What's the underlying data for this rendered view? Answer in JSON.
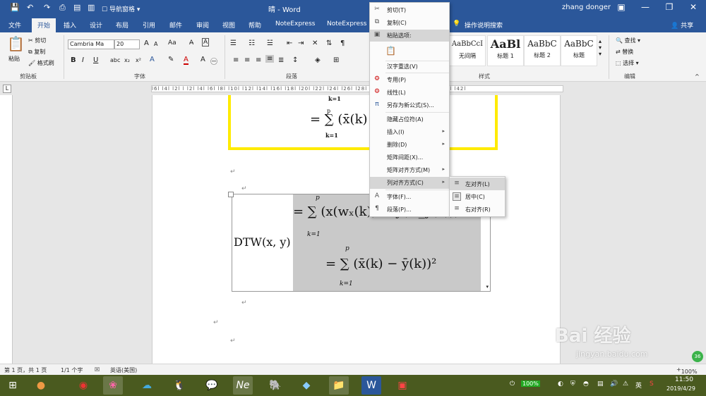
{
  "titlebar": {
    "doc_title": "晴 - Word",
    "nav_pane_label": "导航窗格",
    "user_name": "zhang donger"
  },
  "tabs": [
    "文件",
    "开始",
    "插入",
    "设计",
    "布局",
    "引用",
    "邮件",
    "审阅",
    "视图",
    "帮助",
    "NoteExpress",
    "NoteExpress"
  ],
  "tell_me": "操作说明搜索",
  "share": "共享",
  "ribbon": {
    "clipboard": {
      "paste": "粘贴",
      "cut": "剪切",
      "copy": "复制",
      "format_painter": "格式刷",
      "group": "剪贴板"
    },
    "font": {
      "name": "Cambria Ma",
      "size": "20",
      "grow": "A",
      "shrink": "A",
      "case": "Aa",
      "group": "字体"
    },
    "paragraph": {
      "group": "段落"
    },
    "styles": {
      "group": "样式",
      "items": [
        {
          "sample": "AaBbCcI",
          "name": "无间隔"
        },
        {
          "sample": "AaBl",
          "name": "标题 1"
        },
        {
          "sample": "AaBbC",
          "name": "标题 2"
        },
        {
          "sample": "AaBbC",
          "name": "标题"
        }
      ]
    },
    "editing": {
      "find": "查找",
      "replace": "替换",
      "select": "选择",
      "group": "编辑"
    }
  },
  "ruler_text": "l6l l4l l2l l l2l l4l l6l l8l l10l l12l l14l l16l l18l l20l l22l l24l l26l l28l l30l l32l l34l l36l l38l l40l l42l",
  "document": {
    "upper_eq_top": "k=1",
    "upper_eq_main": "= ∑ (x̄(k)",
    "upper_eq_p": "p",
    "upper_eq_k": "k=1",
    "dtw_label": "DTW(x, y)",
    "eq1": "= ∑ (x(wₓ(k)) − y(w_y(k)))",
    "eq1_p": "p",
    "eq1_k": "k=1",
    "eq2": "= ∑ (x̄(k) − ȳ(k))²",
    "eq2_p": "p",
    "eq2_k": "k=1",
    "para_mark": "↵"
  },
  "context_menu": {
    "items": [
      {
        "icon": "scissors-icon",
        "glyph": "✂",
        "label": "剪切(T)"
      },
      {
        "icon": "copy-icon",
        "glyph": "⧉",
        "label": "复制(C)"
      },
      {
        "icon": "paste-icon",
        "glyph": "📋",
        "label": "粘贴选项:"
      },
      {
        "icon": "",
        "glyph": "",
        "label": "汉字重选(V)"
      },
      {
        "icon": "special-icon",
        "glyph": "⚙",
        "label": "专用(P)"
      },
      {
        "icon": "linear-icon",
        "glyph": "⚙",
        "label": "线性(L)"
      },
      {
        "icon": "save-equation-icon",
        "glyph": "π",
        "label": "另存为新公式(S)..."
      },
      {
        "icon": "",
        "glyph": "",
        "label": "隐藏占位符(A)"
      },
      {
        "icon": "",
        "glyph": "",
        "label": "插入(I)"
      },
      {
        "icon": "",
        "glyph": "",
        "label": "删除(D)"
      },
      {
        "icon": "",
        "glyph": "",
        "label": "矩阵间距(X)..."
      },
      {
        "icon": "",
        "glyph": "",
        "label": "矩阵对齐方式(M)"
      },
      {
        "icon": "",
        "glyph": "",
        "label": "列对齐方式(C)"
      },
      {
        "icon": "font-icon",
        "glyph": "A",
        "label": "字体(F)..."
      },
      {
        "icon": "paragraph-icon",
        "glyph": "¶",
        "label": "段落(P)..."
      }
    ]
  },
  "submenu": {
    "items": [
      {
        "label": "左对齐(L)"
      },
      {
        "label": "居中(C)"
      },
      {
        "label": "右对齐(R)"
      }
    ]
  },
  "statusbar": {
    "page": "第 1 页，共 1 页",
    "words": "1/1 个字",
    "lang": "英语(美国)",
    "zoom": "100%"
  },
  "taskbar": {
    "battery": "100%",
    "ime": "英",
    "time": "11:50",
    "date": "2019/4/29"
  },
  "watermark": {
    "brand": "Bai 经验",
    "url": "jingyan.baidu.com",
    "badge": "36"
  }
}
